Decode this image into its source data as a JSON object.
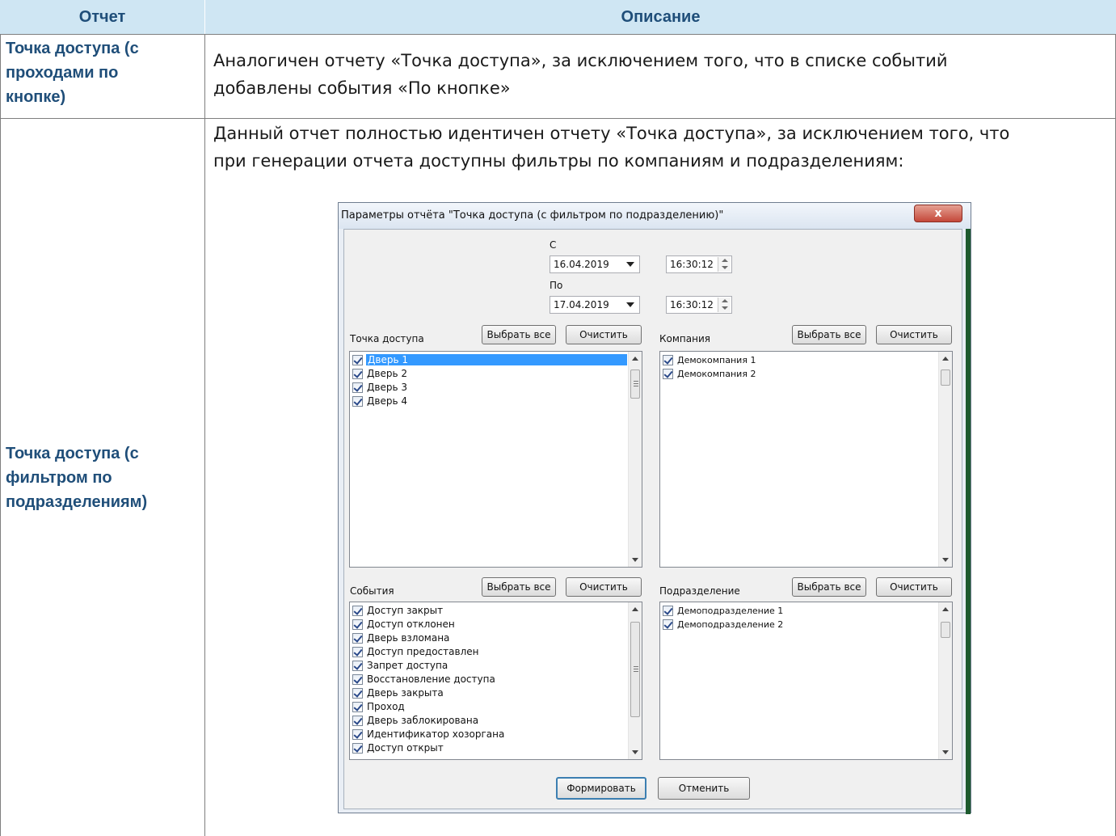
{
  "table": {
    "headers": {
      "col1": "Отчет",
      "col2": "Описание"
    },
    "rows": [
      {
        "label_lines": [
          "Точка доступа (с",
          "проходами по",
          "кнопке)"
        ],
        "text_lines": [
          "Аналогичен отчету «Точка доступа», за исключением того, что в списке событий",
          "добавлены события «По кнопке»"
        ]
      },
      {
        "label_lines": [
          "Точка доступа (с",
          "фильтром по",
          "подразделениям)"
        ],
        "text_lines": [
          "Данный отчет полностью идентичен отчету «Точка доступа», за исключением того, что",
          "при генерации отчета доступны фильтры по компаниям и подразделениям:"
        ]
      }
    ]
  },
  "dialog": {
    "title": "Параметры отчёта \"Точка доступа (с фильтром по подразделению)\"",
    "close_glyph": "x",
    "from_label": "С",
    "from_date": "16.04.2019",
    "from_time": "16:30:12",
    "to_label": "По",
    "to_date": "17.04.2019",
    "to_time": "16:30:12",
    "access_point": {
      "label": "Точка доступа",
      "select_all": "Выбрать все",
      "clear": "Очистить",
      "items": [
        "Дверь 1",
        "Дверь 2",
        "Дверь 3",
        "Дверь 4"
      ]
    },
    "company": {
      "label": "Компания",
      "select_all": "Выбрать все",
      "clear": "Очистить",
      "items": [
        "Демокомпания 1",
        "Демокомпания 2"
      ]
    },
    "events": {
      "label": "События",
      "select_all": "Выбрать все",
      "clear": "Очистить",
      "items": [
        "Доступ закрыт",
        "Доступ отклонен",
        "Дверь взломана",
        "Доступ предоставлен",
        "Запрет доступа",
        "Восстановление доступа",
        "Дверь закрыта",
        "Проход",
        "Дверь заблокирована",
        "Идентификатор хозоргана",
        "Доступ открыт"
      ]
    },
    "department": {
      "label": "Подразделение",
      "select_all": "Выбрать все",
      "clear": "Очистить",
      "items": [
        "Демоподразделение 1",
        "Демоподразделение 2"
      ]
    },
    "generate_button": "Формировать",
    "cancel_button": "Отменить"
  }
}
